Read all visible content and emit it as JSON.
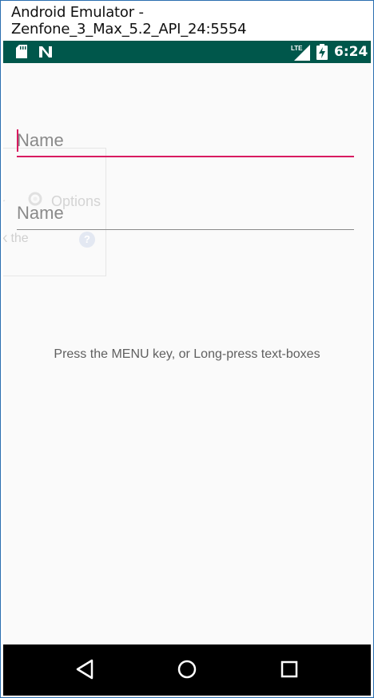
{
  "window": {
    "title": "Android Emulator - Zenfone_3_Max_5.2_API_24:5554"
  },
  "status_bar": {
    "time": "6:24",
    "network": "LTE",
    "icons": [
      "sd-card-icon",
      "n-notification-icon",
      "lte-signal-icon",
      "battery-charging-icon"
    ]
  },
  "ghost_overlay": {
    "options_label": "Options",
    "left_fragment": "r",
    "text_fragment": "k the",
    "help_glyph": "?"
  },
  "form": {
    "field1": {
      "placeholder": "Name",
      "focused": true
    },
    "field2": {
      "placeholder": "Name",
      "focused": false
    }
  },
  "instruction": "Press the MENU key, or Long-press text-boxes",
  "nav_bar": {
    "buttons": [
      "back-icon",
      "home-icon",
      "recent-apps-icon"
    ]
  },
  "colors": {
    "status_bar": "#00574b",
    "accent": "#d81b60",
    "background": "#fafafa",
    "nav_bar": "#000000"
  }
}
